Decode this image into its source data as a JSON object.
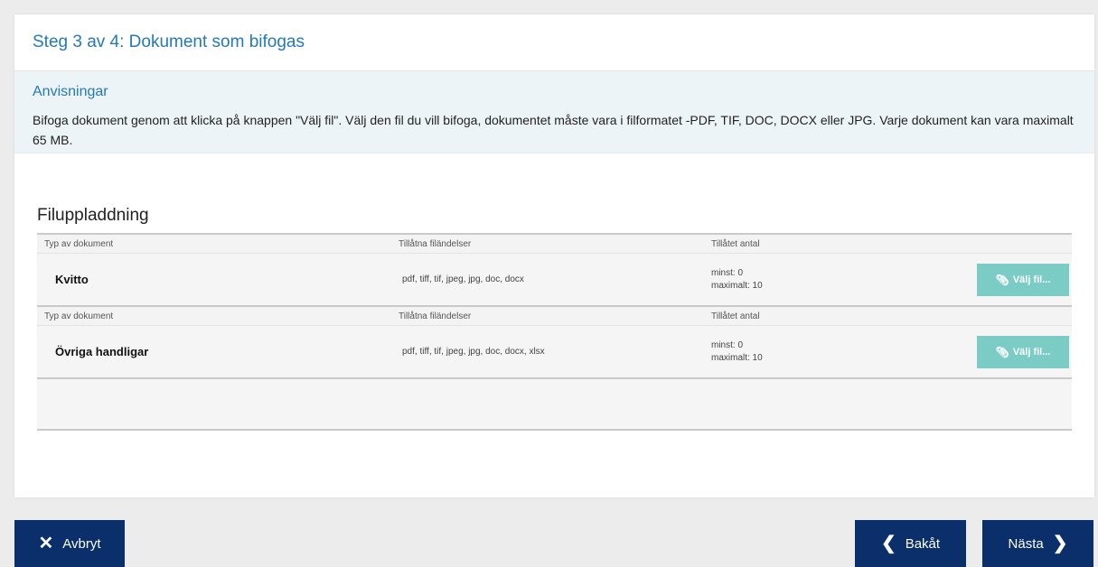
{
  "header": {
    "title": "Steg 3 av 4: Dokument som bifogas"
  },
  "instructions": {
    "title": "Anvisningar",
    "text": "Bifoga dokument genom att klicka på knappen \"Välj fil\". Välj den fil du vill bifoga, dokumentet måste vara i filformatet -PDF, TIF, DOC, DOCX eller JPG. Varje dokument kan vara maximalt 65 MB."
  },
  "upload": {
    "title": "Filuppladdning",
    "documents": [
      {
        "col_type": "Typ av dokument",
        "col_ext": "Tillåtna filändelser",
        "col_count": "Tillåtet antal",
        "name": "Kvitto",
        "extensions": "pdf, tiff, tif, jpeg, jpg, doc, docx",
        "min": "minst: 0",
        "max": "maximalt: 10",
        "button": "Välj fil..."
      },
      {
        "col_type": "Typ av dokument",
        "col_ext": "Tillåtna filändelser",
        "col_count": "Tillåtet antal",
        "name": "Övriga handligar",
        "extensions": "pdf, tiff, tif, jpeg, jpg, doc, docx, xlsx",
        "min": "minst: 0",
        "max": "maximalt: 10",
        "button": "Välj fil..."
      }
    ]
  },
  "footer": {
    "cancel": "Avbryt",
    "back": "Bakåt",
    "next": "Nästa"
  },
  "icons": {
    "cancel": "close-icon",
    "back": "chevron-left-icon",
    "next": "chevron-right-icon",
    "file": "paperclip-icon"
  },
  "colors": {
    "title": "#2479b7",
    "primary_button": "#0b2f6b",
    "file_button": "#7cccc6",
    "instructions_bg": "#edf4f8"
  }
}
